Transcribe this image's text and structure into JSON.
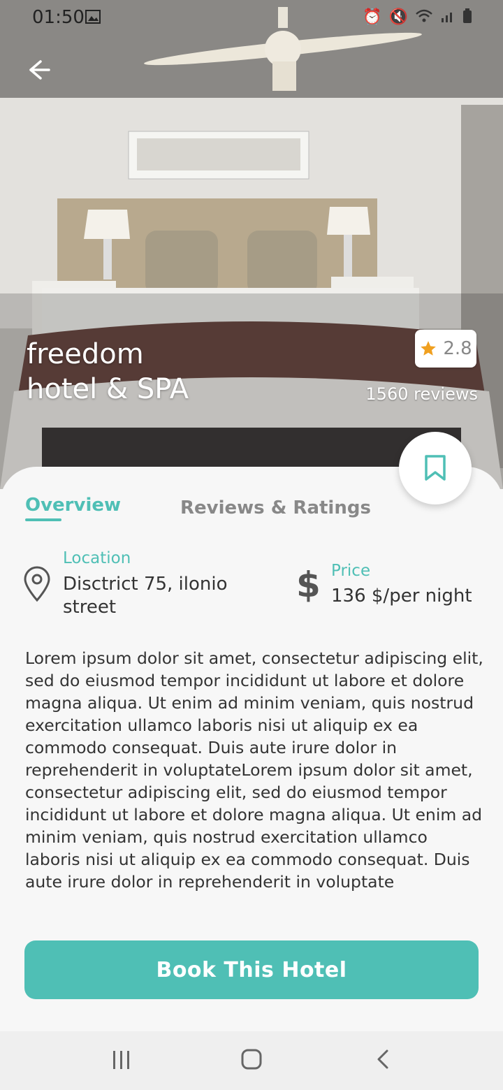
{
  "status_bar": {
    "time": "01:50"
  },
  "hotel": {
    "name_line1": "freedom",
    "name_line2": "hotel & SPA",
    "rating": "2.8",
    "reviews": "1560 reviews"
  },
  "tabs": [
    {
      "label": "Overview",
      "active": true
    },
    {
      "label": "Reviews & Ratings",
      "active": false
    }
  ],
  "location": {
    "label": "Location",
    "value": "Disctrict 75, ilonio street"
  },
  "price": {
    "label": "Price",
    "value": "136 $/per night",
    "icon": "$"
  },
  "description": "Lorem ipsum dolor sit amet, consectetur adipiscing elit, sed do eiusmod tempor incididunt ut labore et dolore magna aliqua. Ut enim ad minim veniam, quis nostrud exercitation ullamco laboris nisi ut aliquip ex ea commodo consequat. Duis aute irure dolor in reprehenderit in voluptateLorem ipsum dolor sit amet, consectetur adipiscing elit, sed do eiusmod tempor incididunt ut labore et dolore magna aliqua. Ut enim ad minim veniam, quis nostrud exercitation ullamco laboris nisi ut aliquip ex ea commodo consequat. Duis aute irure dolor in reprehenderit in voluptate",
  "cta": {
    "label": "Book This Hotel"
  },
  "colors": {
    "accent": "#4fbfb5",
    "star": "#f0a020"
  },
  "icons": [
    "back-arrow-icon",
    "star-icon",
    "bookmark-icon",
    "location-pin-icon",
    "dollar-icon",
    "recents-icon",
    "home-icon",
    "back-icon"
  ]
}
